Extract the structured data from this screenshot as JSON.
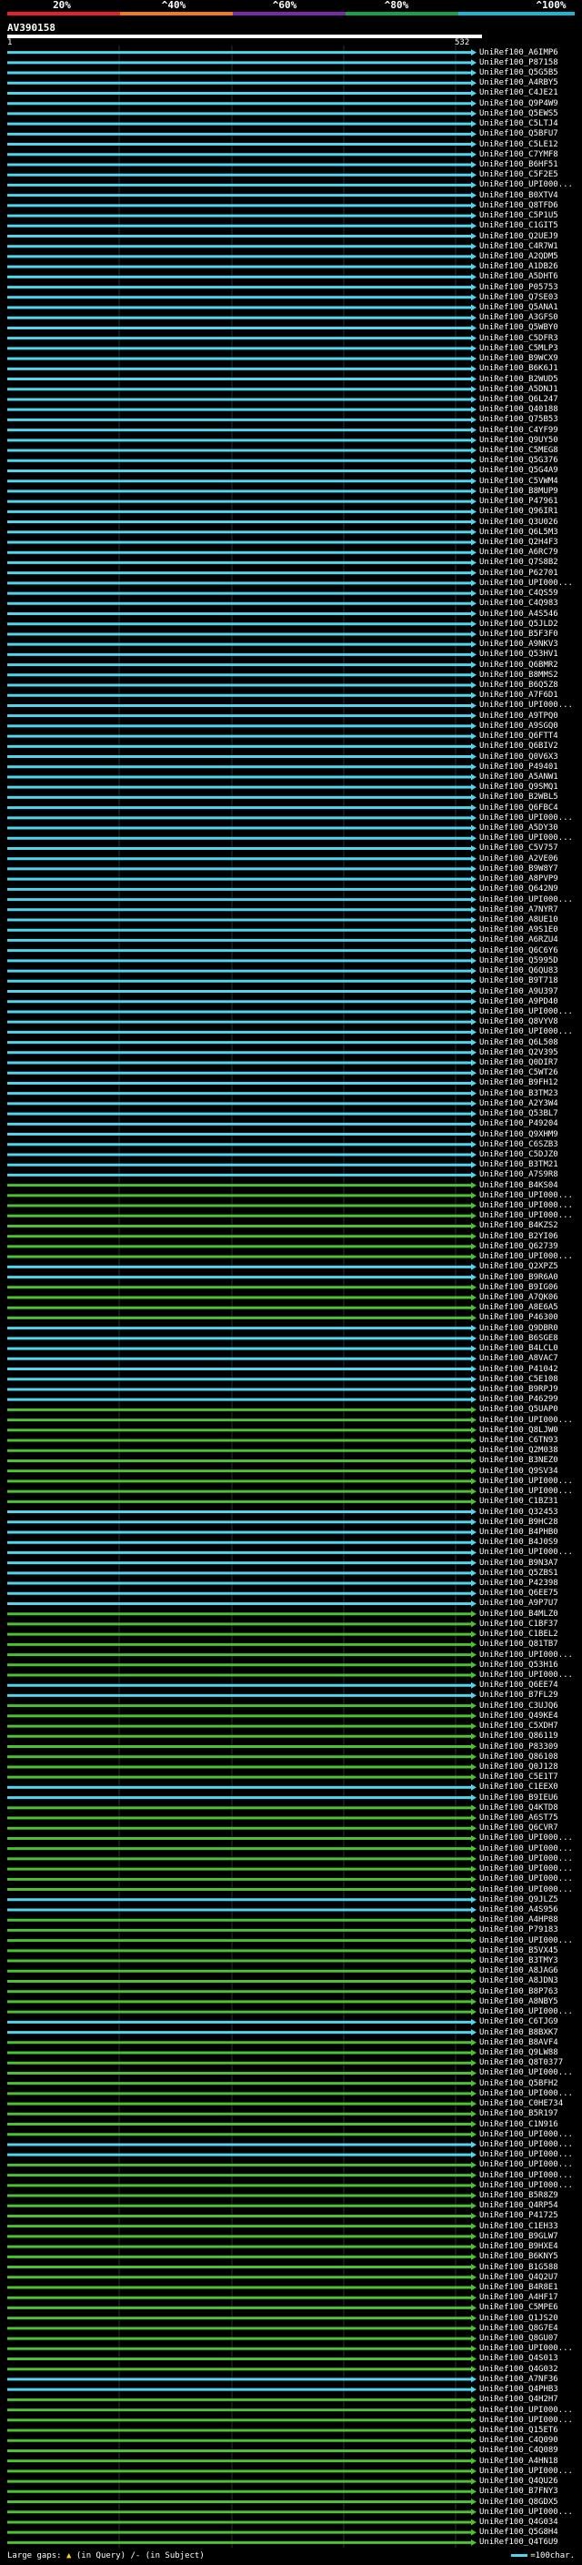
{
  "scale": {
    "labels": [
      "20%",
      "^40%",
      "^60%",
      "^80%",
      "^100%"
    ],
    "colors": [
      "#e8202a",
      "#f07c1c",
      "#7a2aa8",
      "#17a14a",
      "#1ab8d8"
    ]
  },
  "query": {
    "id": "AV390158",
    "start": "1",
    "end": "532"
  },
  "colors": {
    "cyan": "#4fd6ee",
    "green": "#4cc132",
    "gridline": "#26323a"
  },
  "hits": [
    {
      "label": "UniRef100_A6IMP6",
      "color": "cyan"
    },
    {
      "label": "UniRef100_P87158",
      "color": "cyan"
    },
    {
      "label": "UniRef100_Q5G5B5",
      "color": "cyan"
    },
    {
      "label": "UniRef100_A4RBY5",
      "color": "cyan"
    },
    {
      "label": "UniRef100_C4JE21",
      "color": "cyan"
    },
    {
      "label": "UniRef100_Q9P4W9",
      "color": "cyan"
    },
    {
      "label": "UniRef100_Q5EWS5",
      "color": "cyan"
    },
    {
      "label": "UniRef100_C5LTJ4",
      "color": "cyan"
    },
    {
      "label": "UniRef100_Q5BFU7",
      "color": "cyan"
    },
    {
      "label": "UniRef100_C5LE12",
      "color": "cyan"
    },
    {
      "label": "UniRef100_C7YMF8",
      "color": "cyan"
    },
    {
      "label": "UniRef100_B6HF51",
      "color": "cyan"
    },
    {
      "label": "UniRef100_C5F2E5",
      "color": "cyan"
    },
    {
      "label": "UniRef100_UPI000...",
      "color": "cyan"
    },
    {
      "label": "UniRef100_B0XTV4",
      "color": "cyan"
    },
    {
      "label": "UniRef100_Q8TFD6",
      "color": "cyan"
    },
    {
      "label": "UniRef100_C5P1U5",
      "color": "cyan"
    },
    {
      "label": "UniRef100_C1GIT5",
      "color": "cyan"
    },
    {
      "label": "UniRef100_Q2UEJ9",
      "color": "cyan"
    },
    {
      "label": "UniRef100_C4R7W1",
      "color": "cyan"
    },
    {
      "label": "UniRef100_A2QDM5",
      "color": "cyan"
    },
    {
      "label": "UniRef100_A1DB26",
      "color": "cyan"
    },
    {
      "label": "UniRef100_A5DHT6",
      "color": "cyan"
    },
    {
      "label": "UniRef100_P05753",
      "color": "cyan"
    },
    {
      "label": "UniRef100_Q7SE03",
      "color": "cyan"
    },
    {
      "label": "UniRef100_Q5ANA1",
      "color": "cyan"
    },
    {
      "label": "UniRef100_A3GFS0",
      "color": "cyan"
    },
    {
      "label": "UniRef100_Q5WBY0",
      "color": "cyan"
    },
    {
      "label": "UniRef100_C5DFR3",
      "color": "cyan"
    },
    {
      "label": "UniRef100_C5MLP3",
      "color": "cyan"
    },
    {
      "label": "UniRef100_B9WCX9",
      "color": "cyan"
    },
    {
      "label": "UniRef100_B6K6J1",
      "color": "cyan"
    },
    {
      "label": "UniRef100_B2WUD5",
      "color": "cyan"
    },
    {
      "label": "UniRef100_A5DNJ1",
      "color": "cyan"
    },
    {
      "label": "UniRef100_Q6L247",
      "color": "cyan"
    },
    {
      "label": "UniRef100_Q40188",
      "color": "cyan"
    },
    {
      "label": "UniRef100_Q75B53",
      "color": "cyan"
    },
    {
      "label": "UniRef100_C4YF99",
      "color": "cyan"
    },
    {
      "label": "UniRef100_Q9UY50",
      "color": "cyan"
    },
    {
      "label": "UniRef100_C5MEG8",
      "color": "cyan"
    },
    {
      "label": "UniRef100_Q5G376",
      "color": "cyan"
    },
    {
      "label": "UniRef100_Q5G4A9",
      "color": "cyan"
    },
    {
      "label": "UniRef100_C5VWM4",
      "color": "cyan"
    },
    {
      "label": "UniRef100_B8MUP9",
      "color": "cyan"
    },
    {
      "label": "UniRef100_P47961",
      "color": "cyan"
    },
    {
      "label": "UniRef100_Q96IR1",
      "color": "cyan"
    },
    {
      "label": "UniRef100_Q3U026",
      "color": "cyan"
    },
    {
      "label": "UniRef100_Q6L5M3",
      "color": "cyan"
    },
    {
      "label": "UniRef100_Q2H4F3",
      "color": "cyan"
    },
    {
      "label": "UniRef100_A6RC79",
      "color": "cyan"
    },
    {
      "label": "UniRef100_Q7S8B2",
      "color": "cyan"
    },
    {
      "label": "UniRef100_P62701",
      "color": "cyan"
    },
    {
      "label": "UniRef100_UPI000...",
      "color": "cyan"
    },
    {
      "label": "UniRef100_C4QS59",
      "color": "cyan"
    },
    {
      "label": "UniRef100_C4Q983",
      "color": "cyan"
    },
    {
      "label": "UniRef100_A4S546",
      "color": "cyan"
    },
    {
      "label": "UniRef100_Q5JLD2",
      "color": "cyan"
    },
    {
      "label": "UniRef100_B5F3F0",
      "color": "cyan"
    },
    {
      "label": "UniRef100_A9NKV3",
      "color": "cyan"
    },
    {
      "label": "UniRef100_Q53HV1",
      "color": "cyan"
    },
    {
      "label": "UniRef100_Q6BMR2",
      "color": "cyan"
    },
    {
      "label": "UniRef100_B8MMS2",
      "color": "cyan"
    },
    {
      "label": "UniRef100_B6Q5Z8",
      "color": "cyan"
    },
    {
      "label": "UniRef100_A7F6D1",
      "color": "cyan"
    },
    {
      "label": "UniRef100_UPI000...",
      "color": "cyan"
    },
    {
      "label": "UniRef100_A9TPQ0",
      "color": "cyan"
    },
    {
      "label": "UniRef100_A9SGQ0",
      "color": "cyan"
    },
    {
      "label": "UniRef100_Q6FTT4",
      "color": "cyan"
    },
    {
      "label": "UniRef100_Q6BIV2",
      "color": "cyan"
    },
    {
      "label": "UniRef100_Q0V6X3",
      "color": "cyan"
    },
    {
      "label": "UniRef100_P49401",
      "color": "cyan"
    },
    {
      "label": "UniRef100_A5ANW1",
      "color": "cyan"
    },
    {
      "label": "UniRef100_Q9SMQ1",
      "color": "cyan"
    },
    {
      "label": "UniRef100_B2WBL5",
      "color": "cyan"
    },
    {
      "label": "UniRef100_Q6FBC4",
      "color": "cyan"
    },
    {
      "label": "UniRef100_UPI000...",
      "color": "cyan"
    },
    {
      "label": "UniRef100_A5DY30",
      "color": "cyan"
    },
    {
      "label": "UniRef100_UPI000...",
      "color": "cyan"
    },
    {
      "label": "UniRef100_C5V757",
      "color": "cyan"
    },
    {
      "label": "UniRef100_A2VE06",
      "color": "cyan"
    },
    {
      "label": "UniRef100_B9W8Y7",
      "color": "cyan"
    },
    {
      "label": "UniRef100_A8PVP9",
      "color": "cyan"
    },
    {
      "label": "UniRef100_Q642N9",
      "color": "cyan"
    },
    {
      "label": "UniRef100_UPI000...",
      "color": "cyan"
    },
    {
      "label": "UniRef100_A7NYR7",
      "color": "cyan"
    },
    {
      "label": "UniRef100_A8UE10",
      "color": "cyan"
    },
    {
      "label": "UniRef100_A9S1E0",
      "color": "cyan"
    },
    {
      "label": "UniRef100_A6RZU4",
      "color": "cyan"
    },
    {
      "label": "UniRef100_Q6C6Y6",
      "color": "cyan"
    },
    {
      "label": "UniRef100_Q5995D",
      "color": "cyan"
    },
    {
      "label": "UniRef100_Q6QU83",
      "color": "cyan"
    },
    {
      "label": "UniRef100_B9T718",
      "color": "cyan"
    },
    {
      "label": "UniRef100_A9U397",
      "color": "cyan"
    },
    {
      "label": "UniRef100_A9PD40",
      "color": "cyan"
    },
    {
      "label": "UniRef100_UPI000...",
      "color": "cyan"
    },
    {
      "label": "UniRef100_Q8VYV8",
      "color": "cyan"
    },
    {
      "label": "UniRef100_UPI000...",
      "color": "cyan"
    },
    {
      "label": "UniRef100_Q6L508",
      "color": "cyan"
    },
    {
      "label": "UniRef100_Q2V395",
      "color": "cyan"
    },
    {
      "label": "UniRef100_Q0DIR7",
      "color": "cyan"
    },
    {
      "label": "UniRef100_C5WT26",
      "color": "cyan"
    },
    {
      "label": "UniRef100_B9FH12",
      "color": "cyan"
    },
    {
      "label": "UniRef100_B3TM23",
      "color": "cyan"
    },
    {
      "label": "UniRef100_A2Y3W4",
      "color": "cyan"
    },
    {
      "label": "UniRef100_Q53BL7",
      "color": "cyan"
    },
    {
      "label": "UniRef100_P49204",
      "color": "cyan"
    },
    {
      "label": "UniRef100_Q9XHM9",
      "color": "cyan"
    },
    {
      "label": "UniRef100_C6SZB3",
      "color": "cyan"
    },
    {
      "label": "UniRef100_C5DJZ0",
      "color": "cyan"
    },
    {
      "label": "UniRef100_B3TM21",
      "color": "cyan"
    },
    {
      "label": "UniRef100_A7S9R8",
      "color": "cyan"
    },
    {
      "label": "UniRef100_B4KS04",
      "color": "green"
    },
    {
      "label": "UniRef100_UPI000...",
      "color": "green"
    },
    {
      "label": "UniRef100_UPI000...",
      "color": "green"
    },
    {
      "label": "UniRef100_UPI000...",
      "color": "green"
    },
    {
      "label": "UniRef100_B4KZS2",
      "color": "green"
    },
    {
      "label": "UniRef100_B2YI06",
      "color": "green"
    },
    {
      "label": "UniRef100_Q62739",
      "color": "green"
    },
    {
      "label": "UniRef100_UPI000...",
      "color": "green"
    },
    {
      "label": "UniRef100_Q2XPZ5",
      "color": "cyan"
    },
    {
      "label": "UniRef100_B9R6A0",
      "color": "cyan"
    },
    {
      "label": "UniRef100_B9IG06",
      "color": "green"
    },
    {
      "label": "UniRef100_A7QK06",
      "color": "green"
    },
    {
      "label": "UniRef100_A8E6A5",
      "color": "green"
    },
    {
      "label": "UniRef100_P46300",
      "color": "green"
    },
    {
      "label": "UniRef100_Q9DBR0",
      "color": "cyan"
    },
    {
      "label": "UniRef100_B6SGE8",
      "color": "cyan"
    },
    {
      "label": "UniRef100_B4LCL0",
      "color": "cyan"
    },
    {
      "label": "UniRef100_A8VAC7",
      "color": "cyan"
    },
    {
      "label": "UniRef100_P41042",
      "color": "cyan"
    },
    {
      "label": "UniRef100_C5E108",
      "color": "cyan"
    },
    {
      "label": "UniRef100_B9RPJ9",
      "color": "cyan"
    },
    {
      "label": "UniRef100_P46299",
      "color": "cyan"
    },
    {
      "label": "UniRef100_Q5UAP0",
      "color": "green"
    },
    {
      "label": "UniRef100_UPI000...",
      "color": "green"
    },
    {
      "label": "UniRef100_Q8LJW0",
      "color": "green"
    },
    {
      "label": "UniRef100_C6TN93",
      "color": "green"
    },
    {
      "label": "UniRef100_Q2M038",
      "color": "green"
    },
    {
      "label": "UniRef100_B3NEZ0",
      "color": "green"
    },
    {
      "label": "UniRef100_Q9SV34",
      "color": "green"
    },
    {
      "label": "UniRef100_UPI000...",
      "color": "green"
    },
    {
      "label": "UniRef100_UPI000...",
      "color": "green"
    },
    {
      "label": "UniRef100_C1BZ31",
      "color": "green"
    },
    {
      "label": "UniRef100_Q32453",
      "color": "cyan"
    },
    {
      "label": "UniRef100_B9HC28",
      "color": "cyan"
    },
    {
      "label": "UniRef100_B4PHB0",
      "color": "cyan"
    },
    {
      "label": "UniRef100_B4J0S9",
      "color": "cyan"
    },
    {
      "label": "UniRef100_UPI000...",
      "color": "cyan"
    },
    {
      "label": "UniRef100_B9N3A7",
      "color": "cyan"
    },
    {
      "label": "UniRef100_Q5ZBS1",
      "color": "cyan"
    },
    {
      "label": "UniRef100_P42398",
      "color": "cyan"
    },
    {
      "label": "UniRef100_Q6EE75",
      "color": "cyan"
    },
    {
      "label": "UniRef100_A9P7U7",
      "color": "cyan"
    },
    {
      "label": "UniRef100_B4MLZ0",
      "color": "green"
    },
    {
      "label": "UniRef100_C1BF37",
      "color": "green"
    },
    {
      "label": "UniRef100_C1BEL2",
      "color": "green"
    },
    {
      "label": "UniRef100_Q81TB7",
      "color": "green"
    },
    {
      "label": "UniRef100_UPI000...",
      "color": "green"
    },
    {
      "label": "UniRef100_Q53H16",
      "color": "green"
    },
    {
      "label": "UniRef100_UPI000...",
      "color": "green"
    },
    {
      "label": "UniRef100_Q6EE74",
      "color": "cyan"
    },
    {
      "label": "UniRef100_B7FL29",
      "color": "cyan"
    },
    {
      "label": "UniRef100_C3UJQ6",
      "color": "green"
    },
    {
      "label": "UniRef100_Q49KE4",
      "color": "green"
    },
    {
      "label": "UniRef100_C5XDH7",
      "color": "green"
    },
    {
      "label": "UniRef100_Q86119",
      "color": "green"
    },
    {
      "label": "UniRef100_P83309",
      "color": "green"
    },
    {
      "label": "UniRef100_Q86108",
      "color": "green"
    },
    {
      "label": "UniRef100_Q0J128",
      "color": "green"
    },
    {
      "label": "UniRef100_C5E1T7",
      "color": "green"
    },
    {
      "label": "UniRef100_C1EEX0",
      "color": "cyan"
    },
    {
      "label": "UniRef100_B9IEU6",
      "color": "cyan"
    },
    {
      "label": "UniRef100_Q4KTD8",
      "color": "green"
    },
    {
      "label": "UniRef100_A6ST75",
      "color": "green"
    },
    {
      "label": "UniRef100_Q6CVR7",
      "color": "green"
    },
    {
      "label": "UniRef100_UPI000...",
      "color": "green"
    },
    {
      "label": "UniRef100_UPI000...",
      "color": "green"
    },
    {
      "label": "UniRef100_UPI000...",
      "color": "green"
    },
    {
      "label": "UniRef100_UPI000...",
      "color": "green"
    },
    {
      "label": "UniRef100_UPI000...",
      "color": "green"
    },
    {
      "label": "UniRef100_UPI000...",
      "color": "green"
    },
    {
      "label": "UniRef100_Q9JLZ5",
      "color": "cyan"
    },
    {
      "label": "UniRef100_A4S956",
      "color": "cyan"
    },
    {
      "label": "UniRef100_A4HP88",
      "color": "green"
    },
    {
      "label": "UniRef100_P79183",
      "color": "green"
    },
    {
      "label": "UniRef100_UPI000...",
      "color": "green"
    },
    {
      "label": "UniRef100_B5VX45",
      "color": "green"
    },
    {
      "label": "UniRef100_B3TMY3",
      "color": "green"
    },
    {
      "label": "UniRef100_A8JAG6",
      "color": "green"
    },
    {
      "label": "UniRef100_A8JDN3",
      "color": "green"
    },
    {
      "label": "UniRef100_B8P763",
      "color": "green"
    },
    {
      "label": "UniRef100_A8NBY5",
      "color": "green"
    },
    {
      "label": "UniRef100_UPI000...",
      "color": "green"
    },
    {
      "label": "UniRef100_C6TJG9",
      "color": "cyan"
    },
    {
      "label": "UniRef100_B8BXK7",
      "color": "cyan"
    },
    {
      "label": "UniRef100_B8AVF4",
      "color": "green"
    },
    {
      "label": "UniRef100_Q9LW88",
      "color": "green"
    },
    {
      "label": "UniRef100_Q8T0377",
      "color": "green"
    },
    {
      "label": "UniRef100_UPI000...",
      "color": "green"
    },
    {
      "label": "UniRef100_Q5BFH2",
      "color": "green"
    },
    {
      "label": "UniRef100_UPI000...",
      "color": "green"
    },
    {
      "label": "UniRef100_C0HE734",
      "color": "green"
    },
    {
      "label": "UniRef100_B5R197",
      "color": "green"
    },
    {
      "label": "UniRef100_C1N916",
      "color": "green"
    },
    {
      "label": "UniRef100_UPI000...",
      "color": "green"
    },
    {
      "label": "UniRef100_UPI000...",
      "color": "cyan"
    },
    {
      "label": "UniRef100_UPI000...",
      "color": "cyan"
    },
    {
      "label": "UniRef100_UPI000...",
      "color": "green"
    },
    {
      "label": "UniRef100_UPI000...",
      "color": "green"
    },
    {
      "label": "UniRef100_UPI000...",
      "color": "green"
    },
    {
      "label": "UniRef100_B5R8Z9",
      "color": "green"
    },
    {
      "label": "UniRef100_Q4RP54",
      "color": "green"
    },
    {
      "label": "UniRef100_P41725",
      "color": "green"
    },
    {
      "label": "UniRef100_C1EH33",
      "color": "green"
    },
    {
      "label": "UniRef100_B9GLW7",
      "color": "green"
    },
    {
      "label": "UniRef100_B9HXE4",
      "color": "green"
    },
    {
      "label": "UniRef100_B6KNY5",
      "color": "green"
    },
    {
      "label": "UniRef100_B1G588",
      "color": "green"
    },
    {
      "label": "UniRef100_Q4Q2U7",
      "color": "green"
    },
    {
      "label": "UniRef100_B4R8E1",
      "color": "green"
    },
    {
      "label": "UniRef100_A4HF17",
      "color": "green"
    },
    {
      "label": "UniRef100_C5MPE6",
      "color": "green"
    },
    {
      "label": "UniRef100_Q1JS20",
      "color": "green"
    },
    {
      "label": "UniRef100_Q8G7E4",
      "color": "green"
    },
    {
      "label": "UniRef100_Q8GU07",
      "color": "green"
    },
    {
      "label": "UniRef100_UPI000...",
      "color": "green"
    },
    {
      "label": "UniRef100_Q4S013",
      "color": "green"
    },
    {
      "label": "UniRef100_Q4G032",
      "color": "green"
    },
    {
      "label": "UniRef100_A7NF36",
      "color": "cyan"
    },
    {
      "label": "UniRef100_Q4PHB3",
      "color": "cyan"
    },
    {
      "label": "UniRef100_Q4H2H7",
      "color": "green"
    },
    {
      "label": "UniRef100_UPI000...",
      "color": "green"
    },
    {
      "label": "UniRef100_UPI000...",
      "color": "green"
    },
    {
      "label": "UniRef100_Q15ET6",
      "color": "green"
    },
    {
      "label": "UniRef100_C4Q090",
      "color": "green"
    },
    {
      "label": "UniRef100_C4Q089",
      "color": "green"
    },
    {
      "label": "UniRef100_A4HN18",
      "color": "green"
    },
    {
      "label": "UniRef100_UPI000...",
      "color": "green"
    },
    {
      "label": "UniRef100_Q4QU26",
      "color": "green"
    },
    {
      "label": "UniRef100_B7FNY3",
      "color": "green"
    },
    {
      "label": "UniRef100_Q8GDX5",
      "color": "green"
    },
    {
      "label": "UniRef100_UPI000...",
      "color": "green"
    },
    {
      "label": "UniRef100_Q4G034",
      "color": "green"
    },
    {
      "label": "UniRef100_Q5G8H4",
      "color": "green"
    },
    {
      "label": "UniRef100_Q4T6U9",
      "color": "green"
    }
  ],
  "footer": {
    "gaps_label": "Large gaps:",
    "gaps_query": "(in Query)",
    "gaps_subject": "(in Subject)",
    "scale_label": "=100char."
  }
}
